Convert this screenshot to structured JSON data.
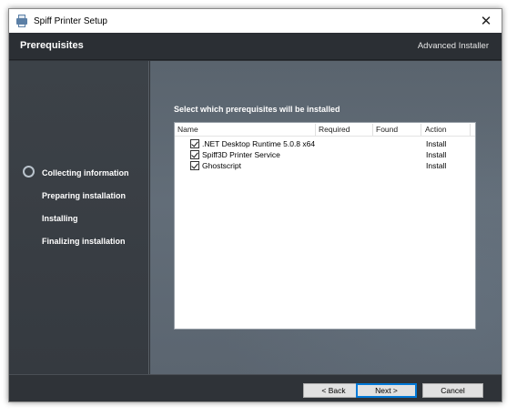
{
  "window": {
    "title": "Spiff Printer Setup",
    "close_glyph": "✕"
  },
  "header": {
    "title": "Prerequisites",
    "brand": "Advanced Installer"
  },
  "sidebar": {
    "steps": [
      {
        "label": "Collecting information",
        "current": true
      },
      {
        "label": "Preparing installation",
        "current": false
      },
      {
        "label": "Installing",
        "current": false
      },
      {
        "label": "Finalizing installation",
        "current": false
      }
    ]
  },
  "content": {
    "instruction": "Select which prerequisites will be installed",
    "columns": [
      "Name",
      "Required",
      "Found",
      "Action"
    ],
    "rows": [
      {
        "name": ".NET Desktop Runtime 5.0.8 x64",
        "checked": true,
        "required": "",
        "found": "",
        "action": "Install"
      },
      {
        "name": "Spiff3D Printer Service",
        "checked": true,
        "required": "",
        "found": "",
        "action": "Install"
      },
      {
        "name": "Ghostscript",
        "checked": true,
        "required": "",
        "found": "",
        "action": "Install"
      }
    ]
  },
  "footer": {
    "back_label": "< Back",
    "next_label": "Next >",
    "cancel_label": "Cancel"
  },
  "icons": {
    "app_icon": "printer-icon",
    "close_icon": "close-icon",
    "step_marker": "current-step-circle-icon",
    "row_checkbox": "checkbox-checked-icon"
  },
  "colors": {
    "header_bg": "#2b2f34",
    "sidebar_bg": "#3a3f45",
    "content_bg": "#5f6a75",
    "primary_button_border": "#0078d7"
  }
}
